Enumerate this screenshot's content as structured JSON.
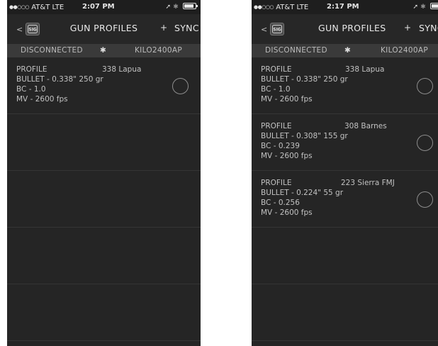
{
  "screens": [
    {
      "status": {
        "signal_dots": "●●○○○",
        "carrier": "AT&T",
        "network": "LTE",
        "time": "2:07 PM",
        "location_glyph": "➚",
        "bt_glyph": "✱"
      },
      "nav": {
        "back_glyph": "<",
        "logo": "SIG",
        "title": "GUN PROFILES",
        "add": "+",
        "sync": "SYNC"
      },
      "connection": {
        "status": "DISCONNECTED",
        "bt_glyph": "✱",
        "device": "KILO2400AP"
      },
      "profiles": [
        {
          "label": "PROFILE",
          "name": "338 Lapua",
          "bullet": "BULLET - 0.338\" 250 gr",
          "bc": "BC - 1.0",
          "mv": "MV - 2600 fps"
        }
      ]
    },
    {
      "status": {
        "signal_dots": "●●○○○",
        "carrier": "AT&T",
        "network": "LTE",
        "time": "2:17 PM",
        "location_glyph": "➚",
        "bt_glyph": "✱"
      },
      "nav": {
        "back_glyph": "<",
        "logo": "SIG",
        "title": "GUN PROFILES",
        "add": "+",
        "sync": "SYNC"
      },
      "connection": {
        "status": "DISCONNECTED",
        "bt_glyph": "✱",
        "device": "KILO2400AP"
      },
      "profiles": [
        {
          "label": "PROFILE",
          "name": "338 Lapua",
          "bullet": "BULLET - 0.338\" 250 gr",
          "bc": "BC - 1.0",
          "mv": "MV - 2600 fps"
        },
        {
          "label": "PROFILE",
          "name": "308 Barnes",
          "bullet": "BULLET - 0.308\" 155 gr",
          "bc": "BC - 0.239",
          "mv": "MV - 2600 fps"
        },
        {
          "label": "PROFILE",
          "name": "223 Sierra FMJ",
          "bullet": "BULLET - 0.224\" 55 gr",
          "bc": "BC - 0.256",
          "mv": "MV - 2600 fps"
        }
      ]
    }
  ]
}
